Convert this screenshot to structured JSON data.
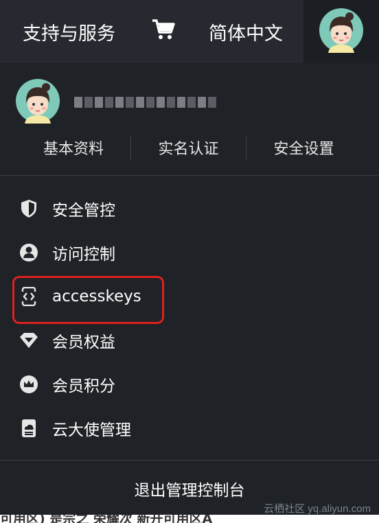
{
  "topbar": {
    "support_label": "支持与服务",
    "cart_icon": "cart-icon",
    "language_label": "简体中文",
    "avatar_icon": "avatar"
  },
  "user": {
    "avatar_icon": "avatar",
    "links": [
      "基本资料",
      "实名认证",
      "安全设置"
    ]
  },
  "menu": {
    "items": [
      {
        "label": "安全管控",
        "icon": "shield-icon"
      },
      {
        "label": "访问控制",
        "icon": "user-circle-icon"
      },
      {
        "label": "accesskeys",
        "icon": "code-key-icon",
        "highlighted": true
      },
      {
        "label": "会员权益",
        "icon": "diamond-icon"
      },
      {
        "label": "会员积分",
        "icon": "crown-icon"
      },
      {
        "label": "云大使管理",
        "icon": "cloud-badge-icon"
      }
    ],
    "logout_label": "退出管理控制台"
  },
  "colors": {
    "topbar_bg": "#262a30",
    "panel_bg": "#1f2226",
    "highlight_border": "#e02020"
  },
  "watermark": "云栖社区 yq.aliyun.com",
  "bottom_text": "可用区) 是宗之 荣耀次 新开可用区A"
}
